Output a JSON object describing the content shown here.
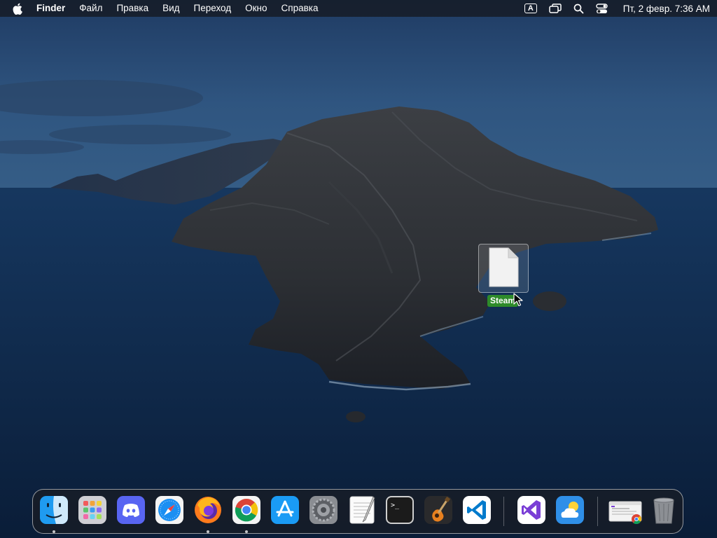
{
  "menubar": {
    "apple_icon": "apple-logo-icon",
    "app_name": "Finder",
    "menus": [
      "Файл",
      "Правка",
      "Вид",
      "Переход",
      "Окно",
      "Справка"
    ],
    "input_source": "A",
    "clock": "Пт, 2 февр.  7:36 AM",
    "status_icons": [
      "input-source-icon",
      "screen-mirroring-icon",
      "spotlight-search-icon",
      "control-center-icon"
    ]
  },
  "desktop": {
    "file": {
      "label": "Steam",
      "icon": "document-alias-icon",
      "selected": true
    }
  },
  "dock": {
    "apps": [
      {
        "icon": "finder-icon",
        "running": true
      },
      {
        "icon": "launchpad-icon",
        "running": false
      },
      {
        "icon": "discord-icon",
        "running": false
      },
      {
        "icon": "safari-icon",
        "running": false
      },
      {
        "icon": "firefox-icon",
        "running": true
      },
      {
        "icon": "chrome-icon",
        "running": true
      },
      {
        "icon": "app-store-icon",
        "running": false
      },
      {
        "icon": "system-preferences-icon",
        "running": false
      },
      {
        "icon": "textedit-icon",
        "running": false
      },
      {
        "icon": "terminal-icon",
        "running": false
      },
      {
        "icon": "garageband-icon",
        "running": false
      },
      {
        "icon": "vscode-icon",
        "running": false
      },
      {
        "icon": "visual-studio-icon",
        "running": false
      },
      {
        "icon": "weather-icon",
        "running": false
      },
      {
        "icon": "recent-window-icon",
        "running": false
      },
      {
        "icon": "trash-icon",
        "running": false
      }
    ],
    "terminal_prompt": ">_"
  },
  "colors": {
    "menubar_bg": "#14181f",
    "file_label_bg": "#2e8b2a",
    "wallpaper_sky": "#2a4a73",
    "wallpaper_sea": "#0e2545"
  }
}
